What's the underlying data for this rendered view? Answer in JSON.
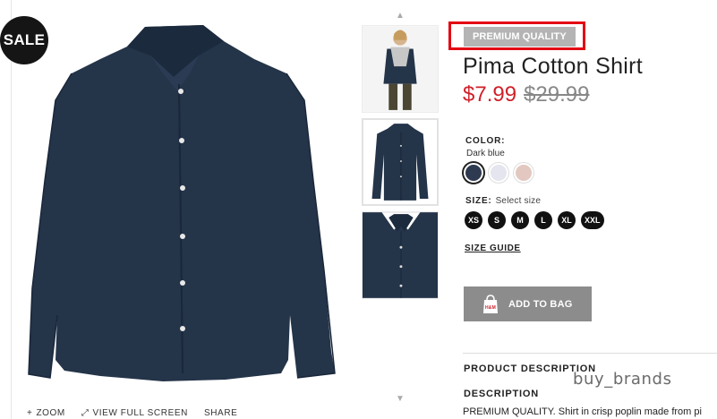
{
  "badges": {
    "sale": "SALE",
    "premium": "PREMIUM QUALITY"
  },
  "image_tools": {
    "zoom": "ZOOM",
    "fullscreen": "VIEW FULL SCREEN",
    "share": "SHARE"
  },
  "product": {
    "title": "Pima Cotton Shirt",
    "price_sale": "$7.99",
    "price_old": "$29.99"
  },
  "color": {
    "label": "COLOR:",
    "value": "Dark blue",
    "swatches": [
      "#2e3a4f",
      "#e4e5ee",
      "#e2c8c0"
    ]
  },
  "size": {
    "label": "SIZE:",
    "hint": "Select size",
    "options": [
      "XS",
      "S",
      "M",
      "L",
      "XL",
      "XXL"
    ]
  },
  "size_guide": "SIZE GUIDE",
  "add_to_bag": "ADD TO BAG",
  "bag_logo": "H&M",
  "product_description_heading": "PRODUCT DESCRIPTION",
  "description_heading": "DESCRIPTION",
  "description_text": "PREMIUM QUALITY. Shirt in crisp poplin made from pi",
  "watermark": "buy_brands",
  "colors": {
    "accent_red": "#d0202a",
    "highlight_box": "#e30613",
    "shirt_navy": "#243449"
  }
}
